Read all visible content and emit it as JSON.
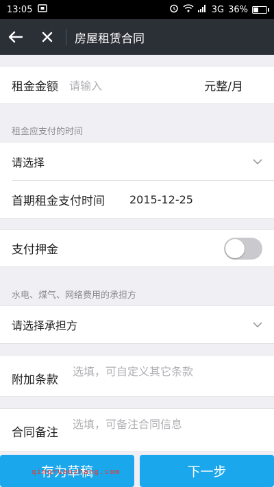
{
  "status_bar": {
    "time": "13:05",
    "network": "3G",
    "battery": "36%",
    "battery_level": 0.36
  },
  "nav": {
    "title": "房屋租赁合同"
  },
  "rent": {
    "label": "租金金额",
    "placeholder": "请输入",
    "unit": "元整/月"
  },
  "pay_time": {
    "section_label": "租金应支付的时间",
    "select_value": "请选择"
  },
  "first_payment": {
    "label": "首期租金支付时间",
    "value": "2015-12-25"
  },
  "deposit": {
    "label": "支付押金",
    "enabled": false
  },
  "utilities": {
    "section_label": "水电、煤气、网络费用的承担方",
    "select_value": "请选择承担方"
  },
  "extra_terms": {
    "label": "附加条款",
    "placeholder": "选填，可自定义其它条款"
  },
  "notes": {
    "label": "合同备注",
    "placeholder": "选填，可备注合同信息"
  },
  "buttons": {
    "save_draft": "存为草稿",
    "next": "下一步"
  },
  "watermark": "qingruanzhang.com",
  "colors": {
    "accent": "#1aa7ec",
    "nav_bg": "#2b2f36"
  }
}
